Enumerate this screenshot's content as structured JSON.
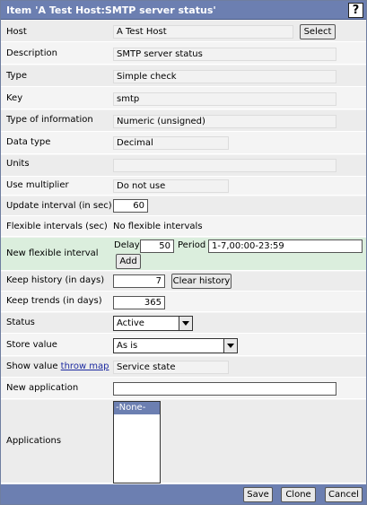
{
  "window": {
    "title": "Item 'A Test Host:SMTP server status'",
    "help_label": "?"
  },
  "form": {
    "host": {
      "label": "Host",
      "value": "A Test Host",
      "select_label": "Select"
    },
    "description": {
      "label": "Description",
      "value": "SMTP server status"
    },
    "type": {
      "label": "Type",
      "value": "Simple check"
    },
    "key": {
      "label": "Key",
      "value": "smtp"
    },
    "type_of_information": {
      "label": "Type of information",
      "value": "Numeric (unsigned)"
    },
    "data_type": {
      "label": "Data type",
      "value": "Decimal"
    },
    "units": {
      "label": "Units",
      "value": ""
    },
    "use_multiplier": {
      "label": "Use multiplier",
      "value": "Do not use"
    },
    "update_interval": {
      "label": "Update interval (in sec)",
      "value": "60"
    },
    "flexible_intervals": {
      "label": "Flexible intervals (sec)",
      "value": "No flexible intervals"
    },
    "new_flexible_interval": {
      "label": "New flexible interval",
      "delay_label": "Delay",
      "delay_value": "50",
      "period_label": "Period",
      "period_value": "1-7,00:00-23:59",
      "add_label": "Add"
    },
    "keep_history": {
      "label": "Keep history (in days)",
      "value": "7",
      "clear_label": "Clear history"
    },
    "keep_trends": {
      "label": "Keep trends (in days)",
      "value": "365"
    },
    "status": {
      "label": "Status",
      "value": "Active"
    },
    "store_value": {
      "label": "Store value",
      "value": "As is"
    },
    "show_value": {
      "label": "Show value",
      "link": "throw map",
      "value": "Service state"
    },
    "new_application": {
      "label": "New application",
      "value": ""
    },
    "applications": {
      "label": "Applications",
      "options": [
        "-None-"
      ]
    }
  },
  "footer": {
    "save_label": "Save",
    "clone_label": "Clone",
    "cancel_label": "Cancel"
  },
  "colors": {
    "titlebar": "#6c7fb1",
    "row_highlight": "#dbeedd",
    "selected_option": "#6c7fb1"
  }
}
